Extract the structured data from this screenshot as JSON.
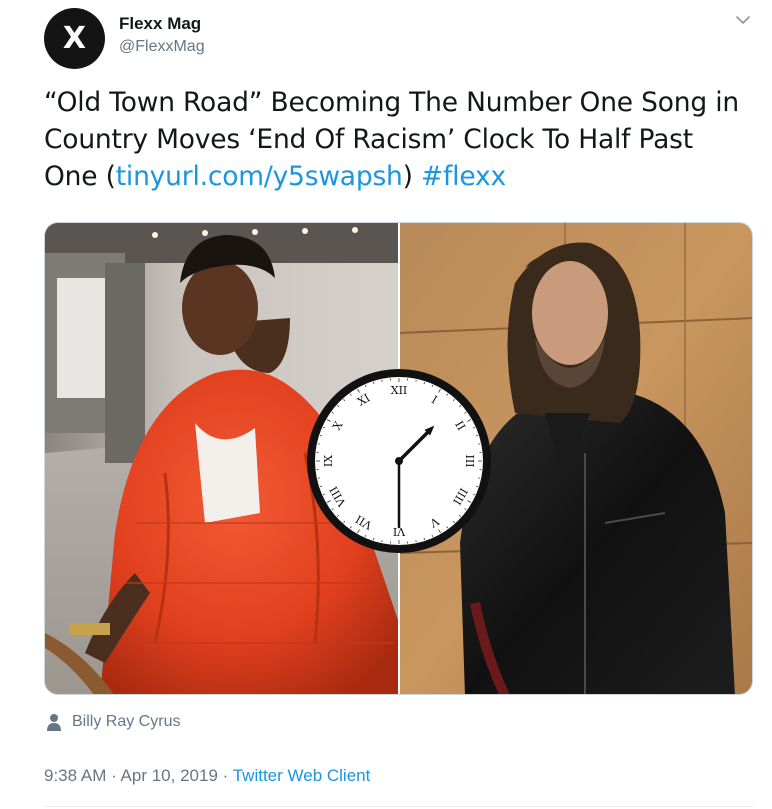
{
  "author": {
    "avatar_letter": "X",
    "name": "Flexx Mag",
    "handle": "@FlexxMag"
  },
  "tweet": {
    "text_main": "“Old Town Road” Becoming The Number One Song in Country Moves ‘End Of Racism’ Clock To Half Past One (",
    "link_url": "tinyurl.com/y5swapsh",
    "text_after_link": ") ",
    "hashtag": "#flexx"
  },
  "media": {
    "clock": {
      "numerals": [
        "XII",
        "I",
        "II",
        "III",
        "IIII",
        "V",
        "VI",
        "VII",
        "VIII",
        "IX",
        "X",
        "XI"
      ],
      "hour": 1,
      "minute": 30
    }
  },
  "tagged_user": {
    "icon": "person-icon",
    "name": "Billy Ray Cyrus"
  },
  "meta": {
    "time": "9:38 AM",
    "separator": " · ",
    "date": "Apr 10, 2019",
    "separator2": " · ",
    "client": "Twitter Web Client"
  },
  "colors": {
    "link": "#1b95e0",
    "secondary": "#657786",
    "jacket": "#e8401f"
  }
}
